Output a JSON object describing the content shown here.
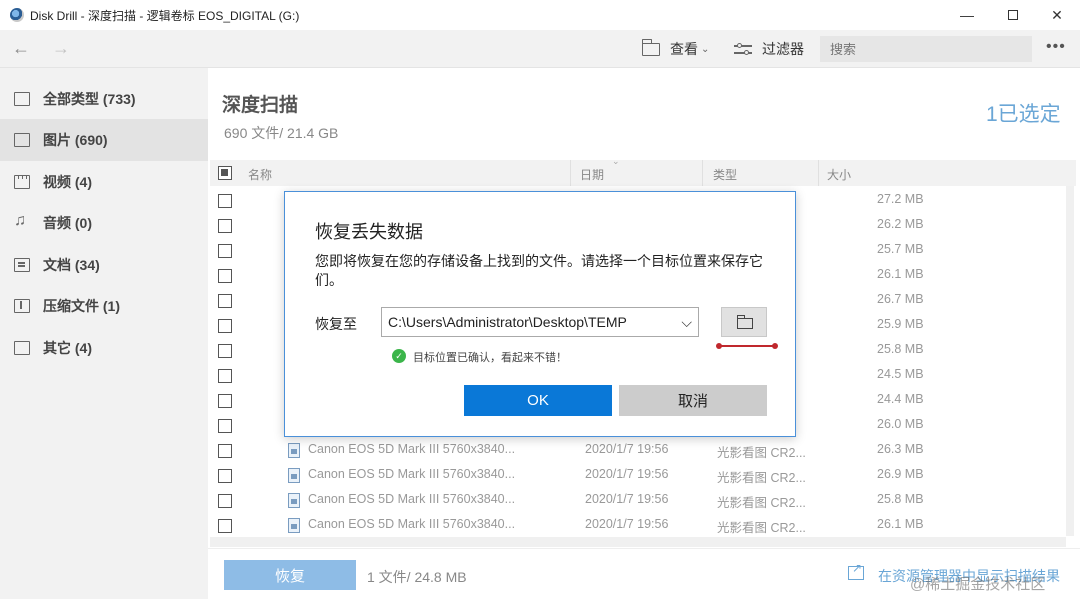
{
  "window": {
    "title": "Disk Drill - 深度扫描 - 逻辑卷标 EOS_DIGITAL (G:)",
    "min_glyph": "—",
    "close_glyph": "✕"
  },
  "toolbar": {
    "back_glyph": "←",
    "forward_glyph": "→",
    "view_label": "查看",
    "view_chevron": "⌄",
    "filter_label": "过滤器",
    "search_placeholder": "搜索",
    "more_glyph": "•••"
  },
  "sidebar": {
    "items": [
      {
        "label": "全部类型 (733)",
        "icon": "all-types-icon"
      },
      {
        "label": "图片 (690)",
        "icon": "picture-icon"
      },
      {
        "label": "视频 (4)",
        "icon": "video-icon"
      },
      {
        "label": "音频 (0)",
        "icon": "audio-icon"
      },
      {
        "label": "文档 (34)",
        "icon": "document-icon"
      },
      {
        "label": "压缩文件 (1)",
        "icon": "archive-icon"
      },
      {
        "label": "其它 (4)",
        "icon": "other-icon"
      }
    ]
  },
  "main": {
    "title": "深度扫描",
    "subtitle": "690 文件/ 21.4 GB",
    "selected": "1已选定"
  },
  "table": {
    "columns": {
      "name": "名称",
      "date": "日期",
      "type": "类型",
      "size": "大小"
    },
    "rows": [
      {
        "name": "",
        "date": "",
        "type": "",
        "size": "27.2 MB"
      },
      {
        "name": "",
        "date": "",
        "type": "",
        "size": "26.2 MB"
      },
      {
        "name": "",
        "date": "",
        "type": "",
        "size": "25.7 MB"
      },
      {
        "name": "",
        "date": "",
        "type": "",
        "size": "26.1 MB"
      },
      {
        "name": "",
        "date": "",
        "type": "",
        "size": "26.7 MB"
      },
      {
        "name": "",
        "date": "",
        "type": "",
        "size": "25.9 MB"
      },
      {
        "name": "",
        "date": "",
        "type": "",
        "size": "25.8 MB"
      },
      {
        "name": "",
        "date": "",
        "type": "",
        "size": "24.5 MB"
      },
      {
        "name": "",
        "date": "",
        "type": "",
        "size": "24.4 MB"
      },
      {
        "name": "",
        "date": "",
        "type": "",
        "size": "26.0 MB"
      },
      {
        "name": "Canon EOS 5D Mark III 5760x3840...",
        "date": "2020/1/7 19:56",
        "type": "光影看图 CR2...",
        "size": "26.3 MB"
      },
      {
        "name": "Canon EOS 5D Mark III 5760x3840...",
        "date": "2020/1/7 19:56",
        "type": "光影看图 CR2...",
        "size": "26.9 MB"
      },
      {
        "name": "Canon EOS 5D Mark III 5760x3840...",
        "date": "2020/1/7 19:56",
        "type": "光影看图 CR2...",
        "size": "25.8 MB"
      },
      {
        "name": "Canon EOS 5D Mark III 5760x3840...",
        "date": "2020/1/7 19:56",
        "type": "光影看图 CR2...",
        "size": "26.1 MB"
      }
    ]
  },
  "bottom": {
    "recover_label": "恢复",
    "info": "1 文件/ 24.8 MB",
    "reveal_link": "在资源管理器中显示扫描结果"
  },
  "dialog": {
    "title": "恢复丢失数据",
    "description": "您即将恢复在您的存储设备上找到的文件。请选择一个目标位置来保存它们。",
    "recover_to_label": "恢复至",
    "path_value": "C:\\Users\\Administrator\\Desktop\\TEMP",
    "path_chevron": "⌵",
    "confirm_message": "目标位置已确认，看起来不错！",
    "check_glyph": "✓",
    "ok_label": "OK",
    "cancel_label": "取消"
  },
  "watermark": "@稀土掘金技术社区",
  "colors": {
    "accent": "#0a78d7",
    "link": "#6aa6d6",
    "confirm_green": "#3bb54a",
    "annotation_red": "#c0282d"
  }
}
